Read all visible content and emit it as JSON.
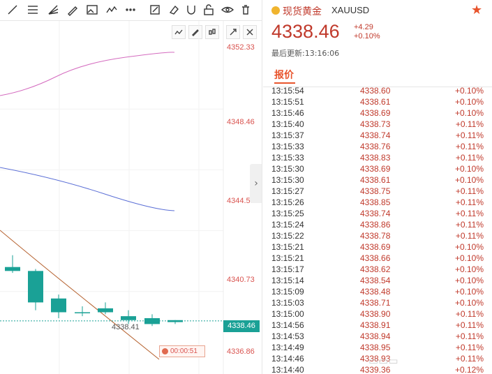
{
  "quote": {
    "name": "现货黄金",
    "symbol": "XAUUSD",
    "price": "4338.46",
    "change": "+4.29",
    "change_pct": "+0.10%",
    "updated": "最后更新:13:16:06",
    "tab": "报价"
  },
  "chart": {
    "y_ticks": [
      "4352.33",
      "4348.46",
      "4344.59",
      "4340.73",
      "4336.86"
    ],
    "price_marker": "4338.46",
    "last_label": "4338.41",
    "timer": "00:00:51",
    "colors": {
      "up": "#1aa196",
      "down": "#c0392b",
      "ma_pink": "#d46bbf",
      "ma_blue": "#5b6fd6",
      "ma_brown": "#b5612e"
    }
  },
  "chart_data": {
    "type": "candlestick",
    "ylim": [
      4336.86,
      4352.33
    ],
    "candles": [
      {
        "open": 4341.2,
        "close": 4341.0,
        "high": 4341.8,
        "low": 4340.9
      },
      {
        "open": 4341.0,
        "close": 4339.4,
        "high": 4341.1,
        "low": 4339.0
      },
      {
        "open": 4339.6,
        "close": 4338.9,
        "high": 4339.8,
        "low": 4338.6
      },
      {
        "open": 4338.9,
        "close": 4338.9,
        "high": 4339.2,
        "low": 4338.7
      },
      {
        "open": 4339.1,
        "close": 4338.9,
        "high": 4339.4,
        "low": 4338.8
      },
      {
        "open": 4338.7,
        "close": 4338.5,
        "high": 4339.0,
        "low": 4338.3
      },
      {
        "open": 4338.6,
        "close": 4338.3,
        "high": 4338.8,
        "low": 4338.2
      },
      {
        "open": 4338.5,
        "close": 4338.4,
        "high": 4338.5,
        "low": 4338.3
      }
    ]
  },
  "ticks": [
    {
      "time": "13:15:54",
      "price": "4338.60",
      "pct": "+0.10%"
    },
    {
      "time": "13:15:51",
      "price": "4338.61",
      "pct": "+0.10%"
    },
    {
      "time": "13:15:46",
      "price": "4338.69",
      "pct": "+0.10%"
    },
    {
      "time": "13:15:40",
      "price": "4338.73",
      "pct": "+0.11%"
    },
    {
      "time": "13:15:37",
      "price": "4338.74",
      "pct": "+0.11%"
    },
    {
      "time": "13:15:33",
      "price": "4338.76",
      "pct": "+0.11%"
    },
    {
      "time": "13:15:33",
      "price": "4338.83",
      "pct": "+0.11%"
    },
    {
      "time": "13:15:30",
      "price": "4338.69",
      "pct": "+0.10%"
    },
    {
      "time": "13:15:30",
      "price": "4338.61",
      "pct": "+0.10%"
    },
    {
      "time": "13:15:27",
      "price": "4338.75",
      "pct": "+0.11%"
    },
    {
      "time": "13:15:26",
      "price": "4338.85",
      "pct": "+0.11%"
    },
    {
      "time": "13:15:25",
      "price": "4338.74",
      "pct": "+0.11%"
    },
    {
      "time": "13:15:24",
      "price": "4338.86",
      "pct": "+0.11%"
    },
    {
      "time": "13:15:22",
      "price": "4338.78",
      "pct": "+0.11%"
    },
    {
      "time": "13:15:21",
      "price": "4338.69",
      "pct": "+0.10%"
    },
    {
      "time": "13:15:21",
      "price": "4338.66",
      "pct": "+0.10%"
    },
    {
      "time": "13:15:17",
      "price": "4338.62",
      "pct": "+0.10%"
    },
    {
      "time": "13:15:14",
      "price": "4338.54",
      "pct": "+0.10%"
    },
    {
      "time": "13:15:09",
      "price": "4338.48",
      "pct": "+0.10%"
    },
    {
      "time": "13:15:03",
      "price": "4338.71",
      "pct": "+0.10%"
    },
    {
      "time": "13:15:00",
      "price": "4338.90",
      "pct": "+0.11%"
    },
    {
      "time": "13:14:56",
      "price": "4338.91",
      "pct": "+0.11%"
    },
    {
      "time": "13:14:53",
      "price": "4338.94",
      "pct": "+0.11%"
    },
    {
      "time": "13:14:49",
      "price": "4338.95",
      "pct": "+0.11%"
    },
    {
      "time": "13:14:46",
      "price": "4338.93",
      "pct": "+0.11%"
    },
    {
      "time": "13:14:40",
      "price": "4339.36",
      "pct": "+0.12%"
    }
  ]
}
